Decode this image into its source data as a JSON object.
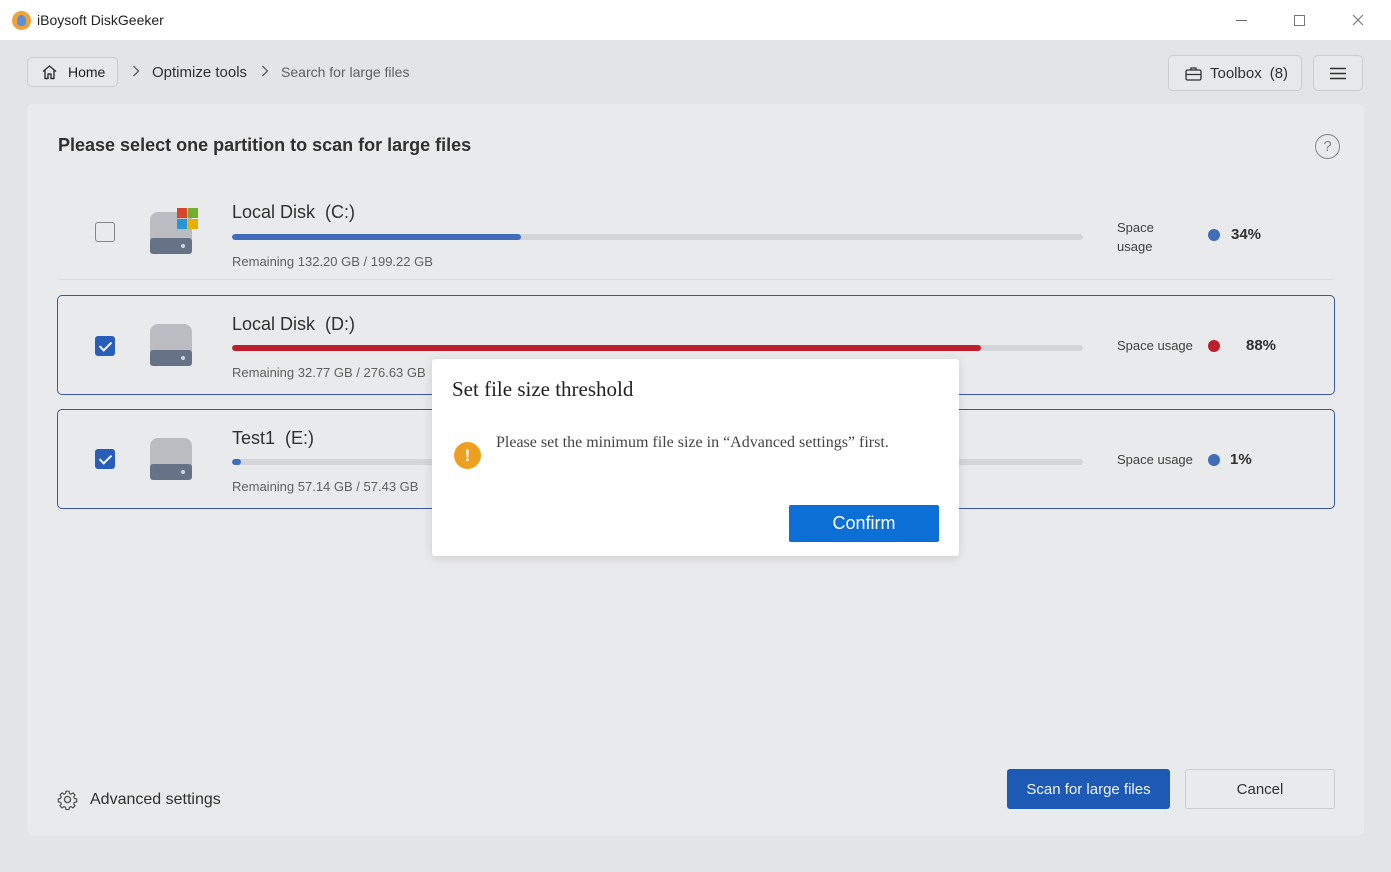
{
  "window": {
    "title": "iBoysoft DiskGeeker"
  },
  "breadcrumb": {
    "home": "Home",
    "items": [
      "Optimize tools",
      "Search for large files"
    ]
  },
  "toolbar": {
    "toolbox_label": "Toolbox",
    "toolbox_count": "(8)"
  },
  "main": {
    "heading": "Please select one partition to scan for large files",
    "disks": [
      {
        "name": "Local Disk",
        "letter": "(C:)",
        "remaining": "Remaining 132.20 GB / 199.22 GB",
        "space_label": "Space usage",
        "usage": "34%",
        "usage_value": 34,
        "checked": false,
        "color": "#4472c4"
      },
      {
        "name": "Local Disk",
        "letter": "(D:)",
        "remaining": "Remaining 32.77 GB / 276.63 GB",
        "space_label": "Space usage",
        "usage": "88%",
        "usage_value": 88,
        "checked": true,
        "color": "#c8202f"
      },
      {
        "name": "Test1",
        "letter": "(E:)",
        "remaining": "Remaining 57.14 GB / 57.43 GB",
        "space_label": "Space usage",
        "usage": "1%",
        "usage_value": 1,
        "checked": true,
        "color": "#4472c4"
      }
    ],
    "advanced_settings": "Advanced settings",
    "scan_button": "Scan for large files",
    "cancel_button": "Cancel"
  },
  "dialog": {
    "title": "Set file size threshold",
    "message": "Please set the minimum file size in “Advanced settings” first.",
    "confirm": "Confirm"
  },
  "colors": {
    "accent": "#1f5fbf",
    "confirm": "#0b6fd6",
    "warning": "#eda01f",
    "usage_blue": "#4472c4",
    "usage_red": "#c8202f"
  }
}
